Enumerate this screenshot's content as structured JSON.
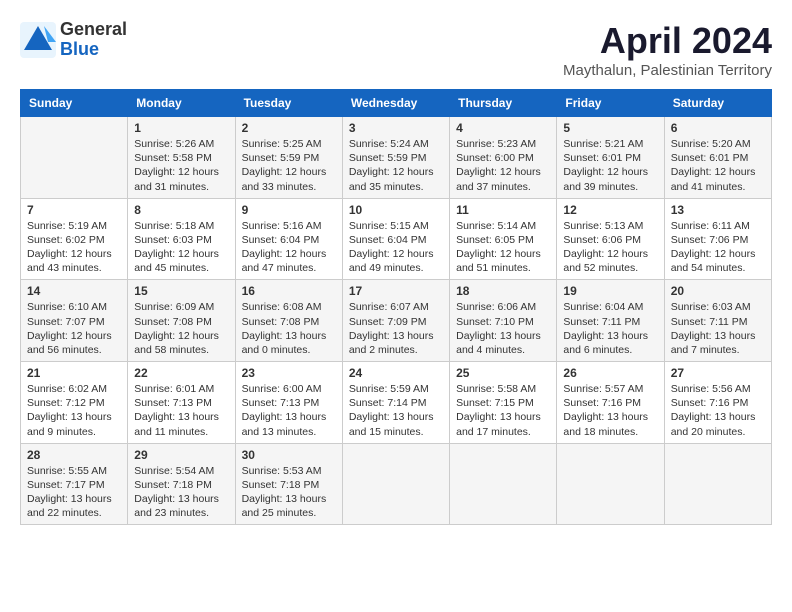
{
  "header": {
    "logo_general": "General",
    "logo_blue": "Blue",
    "month_year": "April 2024",
    "location": "Maythalun, Palestinian Territory"
  },
  "days_of_week": [
    "Sunday",
    "Monday",
    "Tuesday",
    "Wednesday",
    "Thursday",
    "Friday",
    "Saturday"
  ],
  "weeks": [
    [
      {
        "day": "",
        "content": ""
      },
      {
        "day": "1",
        "content": "Sunrise: 5:26 AM\nSunset: 5:58 PM\nDaylight: 12 hours\nand 31 minutes."
      },
      {
        "day": "2",
        "content": "Sunrise: 5:25 AM\nSunset: 5:59 PM\nDaylight: 12 hours\nand 33 minutes."
      },
      {
        "day": "3",
        "content": "Sunrise: 5:24 AM\nSunset: 5:59 PM\nDaylight: 12 hours\nand 35 minutes."
      },
      {
        "day": "4",
        "content": "Sunrise: 5:23 AM\nSunset: 6:00 PM\nDaylight: 12 hours\nand 37 minutes."
      },
      {
        "day": "5",
        "content": "Sunrise: 5:21 AM\nSunset: 6:01 PM\nDaylight: 12 hours\nand 39 minutes."
      },
      {
        "day": "6",
        "content": "Sunrise: 5:20 AM\nSunset: 6:01 PM\nDaylight: 12 hours\nand 41 minutes."
      }
    ],
    [
      {
        "day": "7",
        "content": "Sunrise: 5:19 AM\nSunset: 6:02 PM\nDaylight: 12 hours\nand 43 minutes."
      },
      {
        "day": "8",
        "content": "Sunrise: 5:18 AM\nSunset: 6:03 PM\nDaylight: 12 hours\nand 45 minutes."
      },
      {
        "day": "9",
        "content": "Sunrise: 5:16 AM\nSunset: 6:04 PM\nDaylight: 12 hours\nand 47 minutes."
      },
      {
        "day": "10",
        "content": "Sunrise: 5:15 AM\nSunset: 6:04 PM\nDaylight: 12 hours\nand 49 minutes."
      },
      {
        "day": "11",
        "content": "Sunrise: 5:14 AM\nSunset: 6:05 PM\nDaylight: 12 hours\nand 51 minutes."
      },
      {
        "day": "12",
        "content": "Sunrise: 5:13 AM\nSunset: 6:06 PM\nDaylight: 12 hours\nand 52 minutes."
      },
      {
        "day": "13",
        "content": "Sunrise: 6:11 AM\nSunset: 7:06 PM\nDaylight: 12 hours\nand 54 minutes."
      }
    ],
    [
      {
        "day": "14",
        "content": "Sunrise: 6:10 AM\nSunset: 7:07 PM\nDaylight: 12 hours\nand 56 minutes."
      },
      {
        "day": "15",
        "content": "Sunrise: 6:09 AM\nSunset: 7:08 PM\nDaylight: 12 hours\nand 58 minutes."
      },
      {
        "day": "16",
        "content": "Sunrise: 6:08 AM\nSunset: 7:08 PM\nDaylight: 13 hours\nand 0 minutes."
      },
      {
        "day": "17",
        "content": "Sunrise: 6:07 AM\nSunset: 7:09 PM\nDaylight: 13 hours\nand 2 minutes."
      },
      {
        "day": "18",
        "content": "Sunrise: 6:06 AM\nSunset: 7:10 PM\nDaylight: 13 hours\nand 4 minutes."
      },
      {
        "day": "19",
        "content": "Sunrise: 6:04 AM\nSunset: 7:11 PM\nDaylight: 13 hours\nand 6 minutes."
      },
      {
        "day": "20",
        "content": "Sunrise: 6:03 AM\nSunset: 7:11 PM\nDaylight: 13 hours\nand 7 minutes."
      }
    ],
    [
      {
        "day": "21",
        "content": "Sunrise: 6:02 AM\nSunset: 7:12 PM\nDaylight: 13 hours\nand 9 minutes."
      },
      {
        "day": "22",
        "content": "Sunrise: 6:01 AM\nSunset: 7:13 PM\nDaylight: 13 hours\nand 11 minutes."
      },
      {
        "day": "23",
        "content": "Sunrise: 6:00 AM\nSunset: 7:13 PM\nDaylight: 13 hours\nand 13 minutes."
      },
      {
        "day": "24",
        "content": "Sunrise: 5:59 AM\nSunset: 7:14 PM\nDaylight: 13 hours\nand 15 minutes."
      },
      {
        "day": "25",
        "content": "Sunrise: 5:58 AM\nSunset: 7:15 PM\nDaylight: 13 hours\nand 17 minutes."
      },
      {
        "day": "26",
        "content": "Sunrise: 5:57 AM\nSunset: 7:16 PM\nDaylight: 13 hours\nand 18 minutes."
      },
      {
        "day": "27",
        "content": "Sunrise: 5:56 AM\nSunset: 7:16 PM\nDaylight: 13 hours\nand 20 minutes."
      }
    ],
    [
      {
        "day": "28",
        "content": "Sunrise: 5:55 AM\nSunset: 7:17 PM\nDaylight: 13 hours\nand 22 minutes."
      },
      {
        "day": "29",
        "content": "Sunrise: 5:54 AM\nSunset: 7:18 PM\nDaylight: 13 hours\nand 23 minutes."
      },
      {
        "day": "30",
        "content": "Sunrise: 5:53 AM\nSunset: 7:18 PM\nDaylight: 13 hours\nand 25 minutes."
      },
      {
        "day": "",
        "content": ""
      },
      {
        "day": "",
        "content": ""
      },
      {
        "day": "",
        "content": ""
      },
      {
        "day": "",
        "content": ""
      }
    ]
  ]
}
